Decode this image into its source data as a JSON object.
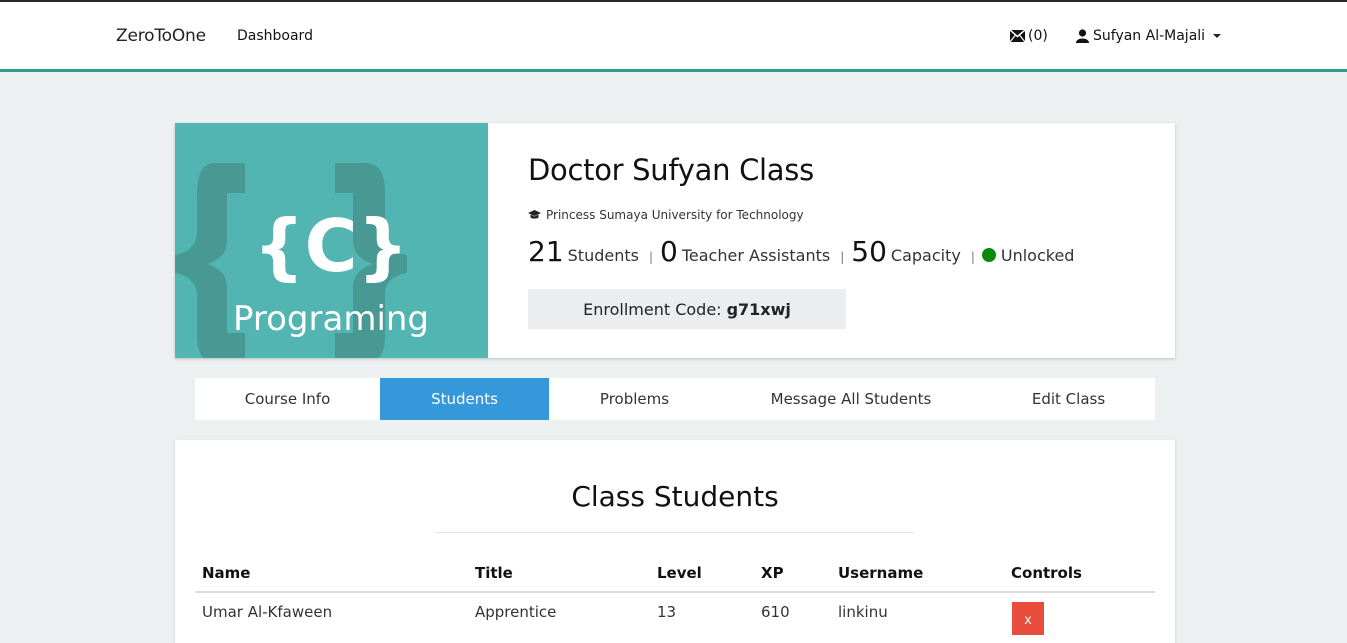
{
  "navbar": {
    "brand": "ZeroToOne",
    "dashboard_link": "Dashboard",
    "messages_count": "(0)",
    "user_name": "Sufyan Al-Majali"
  },
  "class_info": {
    "image_text_top": "{C}",
    "image_text_bottom": "Programing",
    "title": "Doctor Sufyan Class",
    "university": "Princess Sumaya University for Technology",
    "students_count": "21",
    "students_label": "Students",
    "ta_count": "0",
    "ta_label": "Teacher Assistants",
    "capacity_count": "50",
    "capacity_label": "Capacity",
    "separator": "|",
    "status": "Unlocked",
    "status_color": "#0a8a0a",
    "enrollment_label": "Enrollment Code:",
    "enrollment_code": "g71xwj"
  },
  "tabs": [
    {
      "label": "Course Info",
      "active": false
    },
    {
      "label": "Students",
      "active": true
    },
    {
      "label": "Problems",
      "active": false
    },
    {
      "label": "Message All Students",
      "active": false
    },
    {
      "label": "Edit Class",
      "active": false
    }
  ],
  "students_section": {
    "title": "Class Students",
    "columns": [
      "Name",
      "Title",
      "Level",
      "XP",
      "Username",
      "Controls"
    ],
    "rows": [
      {
        "name": "Umar Al-Kfaween",
        "title": "Apprentice",
        "level": "13",
        "xp": "610",
        "username": "linkinu",
        "control_label": "x"
      }
    ]
  },
  "colors": {
    "accent": "#2a9d8f",
    "active_tab": "#3498db",
    "danger": "#e74c3c",
    "course_image_bg": "#52b5b1"
  }
}
